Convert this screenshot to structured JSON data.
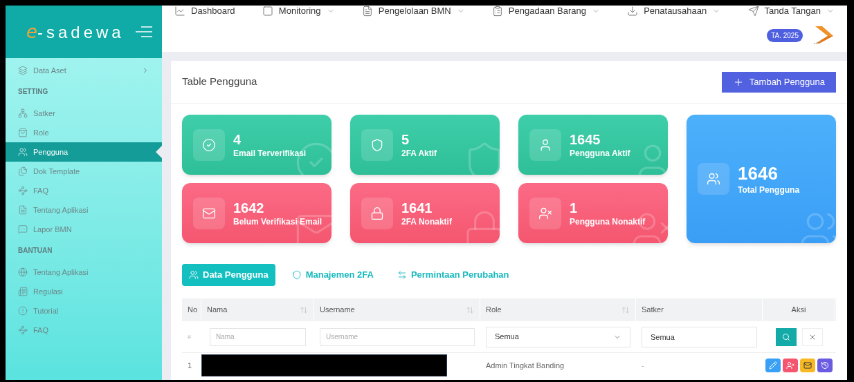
{
  "logo": {
    "mark": "e",
    "text": "-sadewa"
  },
  "top_nav": [
    {
      "label": "Dashboard",
      "dropdown": false
    },
    {
      "label": "Monitoring",
      "dropdown": true
    },
    {
      "label": "Pengelolaan BMN",
      "dropdown": true
    },
    {
      "label": "Pengadaan Barang",
      "dropdown": true
    },
    {
      "label": "Penatausahaan",
      "dropdown": true
    },
    {
      "label": "Tanda Tangan",
      "dropdown": true
    }
  ],
  "year_badge": "TA. 2025",
  "sidebar": {
    "sections": [
      {
        "items": [
          {
            "label": "Data Aset",
            "selected": false,
            "expandable": true
          }
        ]
      },
      {
        "title": "SETTING",
        "items": [
          {
            "label": "Satker",
            "selected": false
          },
          {
            "label": "Role",
            "selected": false
          },
          {
            "label": "Pengguna",
            "selected": true
          },
          {
            "label": "Dok Template",
            "selected": false
          },
          {
            "label": "FAQ",
            "selected": false
          },
          {
            "label": "Tentang Aplikasi",
            "selected": false
          },
          {
            "label": "Lapor BMN",
            "selected": false
          }
        ]
      },
      {
        "title": "BANTUAN",
        "items": [
          {
            "label": "Tentang Aplikasi",
            "selected": false
          },
          {
            "label": "Regulasi",
            "selected": false
          },
          {
            "label": "Tutorial",
            "selected": false
          },
          {
            "label": "FAQ",
            "selected": false
          }
        ]
      }
    ]
  },
  "page_title": "Table Pengguna",
  "add_button": "Tambah Pengguna",
  "stats": [
    {
      "value": "4",
      "label": "Email Terverifikasi",
      "kind": "success"
    },
    {
      "value": "5",
      "label": "2FA Aktif",
      "kind": "success"
    },
    {
      "value": "1645",
      "label": "Pengguna Aktif",
      "kind": "success"
    },
    {
      "value": "1646",
      "label": "Total Pengguna",
      "kind": "total"
    },
    {
      "value": "1642",
      "label": "Belum Verifikasi Email",
      "kind": "danger"
    },
    {
      "value": "1641",
      "label": "2FA Nonaktif",
      "kind": "danger"
    },
    {
      "value": "1",
      "label": "Pengguna Nonaktif",
      "kind": "danger"
    }
  ],
  "tabs": [
    {
      "label": "Data Pengguna",
      "selected": true
    },
    {
      "label": "Manajemen 2FA",
      "selected": false
    },
    {
      "label": "Permintaan Perubahan",
      "selected": false
    }
  ],
  "table": {
    "columns": [
      {
        "label": "No",
        "sortable": false
      },
      {
        "label": "Nama",
        "sortable": true
      },
      {
        "label": "Username",
        "sortable": true
      },
      {
        "label": "Role",
        "sortable": true
      },
      {
        "label": "Satker",
        "sortable": false
      },
      {
        "label": "Aksi",
        "sortable": false
      }
    ],
    "filters": {
      "no_mark": "#",
      "nama_placeholder": "Nama",
      "username_placeholder": "Username",
      "role": "Semua",
      "satker": "Semua"
    },
    "rows": [
      {
        "no": "1",
        "redacted": true,
        "role": "Admin Tingkat Banding",
        "satker": "-"
      }
    ]
  }
}
